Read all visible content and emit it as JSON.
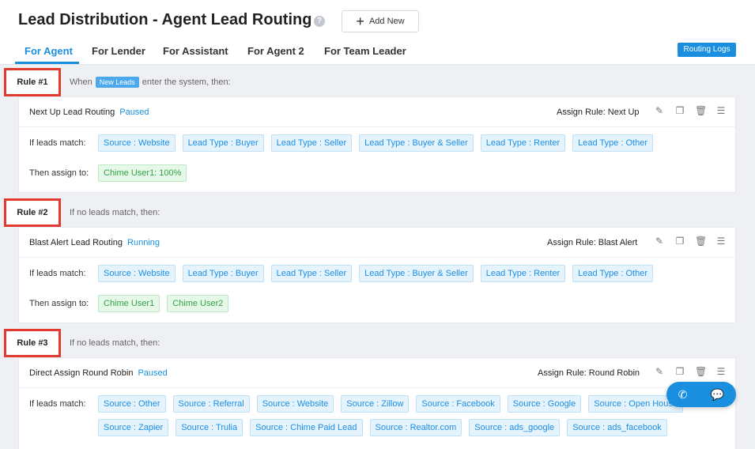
{
  "header": {
    "title": "Lead Distribution - Agent Lead Routing",
    "help_icon": "?",
    "add_new_label": "Add New",
    "routing_logs_label": "Routing Logs"
  },
  "tabs": [
    {
      "label": "For Agent",
      "active": true
    },
    {
      "label": "For Lender",
      "active": false
    },
    {
      "label": "For Assistant",
      "active": false
    },
    {
      "label": "For Agent 2",
      "active": false
    },
    {
      "label": "For Team Leader",
      "active": false
    }
  ],
  "colors": {
    "accent": "#1a8fe0",
    "rule_highlight": "#e23a2e",
    "chip_blue": "#1d8ee3",
    "chip_green": "#35a146"
  },
  "labels": {
    "if_leads_match": "If leads match:",
    "then_assign_to": "Then assign to:"
  },
  "rules": [
    {
      "label": "Rule #1",
      "condition_before": "When",
      "condition_tag": "New Leads",
      "condition_after": "enter the system, then:",
      "name": "Next Up Lead Routing",
      "status": "Paused",
      "assign_rule": "Assign Rule: Next Up",
      "match_tags": [
        "Source : Website",
        "Lead Type : Buyer",
        "Lead Type : Seller",
        "Lead Type : Buyer & Seller",
        "Lead Type : Renter",
        "Lead Type : Other"
      ],
      "assignees": [
        "Chime User1: 100%"
      ]
    },
    {
      "label": "Rule #2",
      "condition_before": "If no leads match, then:",
      "name": "Blast Alert Lead Routing",
      "status": "Running",
      "assign_rule": "Assign Rule: Blast Alert",
      "match_tags": [
        "Source : Website",
        "Lead Type : Buyer",
        "Lead Type : Seller",
        "Lead Type : Buyer & Seller",
        "Lead Type : Renter",
        "Lead Type : Other"
      ],
      "assignees": [
        "Chime User1",
        "Chime User2"
      ]
    },
    {
      "label": "Rule #3",
      "condition_before": "If no leads match, then:",
      "name": "Direct Assign Round Robin",
      "status": "Paused",
      "assign_rule": "Assign Rule: Round Robin",
      "match_tags_row1": [
        "Source : Other",
        "Source : Referral",
        "Source : Website",
        "Source : Zillow",
        "Source : Facebook",
        "Source : Google",
        "Source : Open House"
      ],
      "match_tags_row2": [
        "Source : Zapier",
        "Source : Trulia",
        "Source : Chime Paid Lead",
        "Source : Realtor.com",
        "Source : ads_google",
        "Source : ads_facebook"
      ]
    }
  ],
  "fab": {
    "phone_icon": "phone-icon",
    "chat_icon": "chat-icon"
  }
}
